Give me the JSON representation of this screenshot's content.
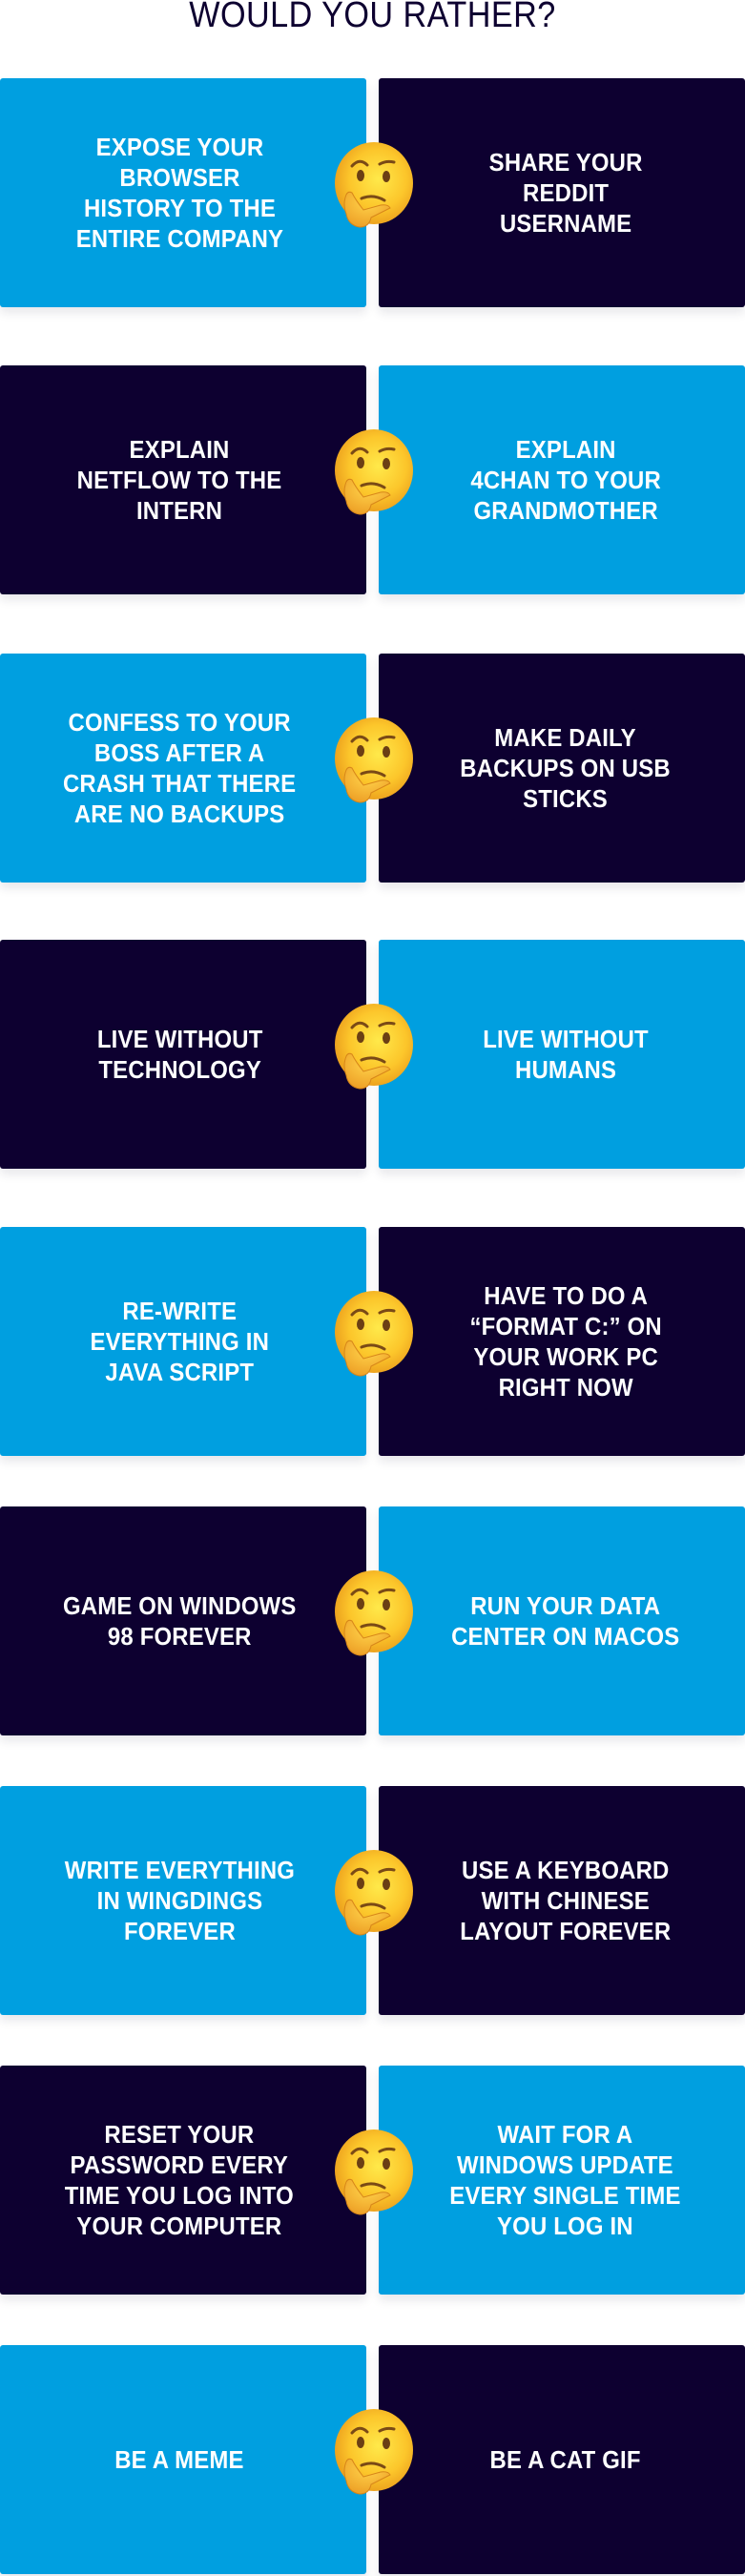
{
  "page": {
    "title": "WOULD YOU RATHER?"
  },
  "colors": {
    "blue": "#009fe0",
    "navy": "#0d0030",
    "text": "#ffffff",
    "title": "#0d0030"
  },
  "emoji_icon": "thinking-face-icon",
  "questions": [
    {
      "left": {
        "text": "EXPOSE YOUR\nBROWSER\nHISTORY TO THE\nENTIRE COMPANY",
        "color": "blue"
      },
      "right": {
        "text": "SHARE YOUR\nREDDIT\nUSERNAME",
        "color": "navy"
      }
    },
    {
      "left": {
        "text": "EXPLAIN\nNETFLOW TO THE\nINTERN",
        "color": "navy"
      },
      "right": {
        "text": "EXPLAIN\n4CHAN TO YOUR\nGRANDMOTHER",
        "color": "blue"
      }
    },
    {
      "left": {
        "text": "CONFESS TO YOUR\nBOSS AFTER A\nCRASH THAT THERE\nARE NO BACKUPS",
        "color": "blue"
      },
      "right": {
        "text": "MAKE DAILY\nBACKUPS ON USB\nSTICKS",
        "color": "navy"
      }
    },
    {
      "left": {
        "text": "LIVE WITHOUT\nTECHNOLOGY",
        "color": "navy"
      },
      "right": {
        "text": "LIVE WITHOUT\nHUMANS",
        "color": "blue"
      }
    },
    {
      "left": {
        "text": "RE-WRITE\nEVERYTHING IN\nJAVA SCRIPT",
        "color": "blue"
      },
      "right": {
        "text": "HAVE TO DO A\n“FORMAT C:” ON\nYOUR WORK PC\nRIGHT NOW",
        "color": "navy"
      }
    },
    {
      "left": {
        "text": "GAME ON WINDOWS\n98 FOREVER",
        "color": "navy"
      },
      "right": {
        "text": "RUN YOUR DATA\nCENTER ON MACOS",
        "color": "blue"
      }
    },
    {
      "left": {
        "text": "WRITE EVERYTHING\nIN WINGDINGS\nFOREVER",
        "color": "blue"
      },
      "right": {
        "text": "USE A KEYBOARD\nWITH CHINESE\nLAYOUT FOREVER",
        "color": "navy"
      }
    },
    {
      "left": {
        "text": "RESET YOUR\nPASSWORD EVERY\nTIME YOU LOG INTO\nYOUR COMPUTER",
        "color": "navy"
      },
      "right": {
        "text": "WAIT FOR A\nWINDOWS UPDATE\nEVERY SINGLE TIME\nYOU LOG IN",
        "color": "blue"
      }
    },
    {
      "left": {
        "text": "BE A MEME",
        "color": "blue"
      },
      "right": {
        "text": "BE A CAT GIF",
        "color": "navy"
      }
    }
  ]
}
